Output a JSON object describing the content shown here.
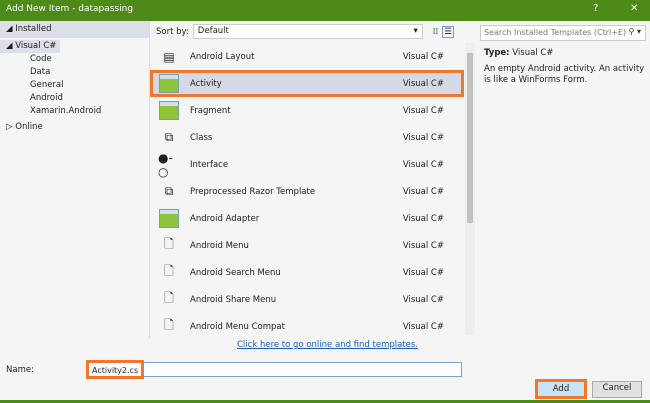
{
  "window": {
    "title": "Add New Item - datapassing",
    "help": "?",
    "close": "✕"
  },
  "sidebar": {
    "installed": "Installed",
    "tree": [
      "Visual C#",
      "Code",
      "Data",
      "General",
      "Android",
      "Xamarin.Android"
    ],
    "online": "Online"
  },
  "sort": {
    "label": "Sort by:",
    "value": "Default"
  },
  "templates": [
    {
      "name": "Android Layout",
      "lang": "Visual C#",
      "icon": "layout-icon"
    },
    {
      "name": "Activity",
      "lang": "Visual C#",
      "icon": "android-icon",
      "selected": true
    },
    {
      "name": "Fragment",
      "lang": "Visual C#",
      "icon": "android-icon"
    },
    {
      "name": "Class",
      "lang": "Visual C#",
      "icon": "class-icon"
    },
    {
      "name": "Interface",
      "lang": "Visual C#",
      "icon": "interface-icon"
    },
    {
      "name": "Preprocessed Razor Template",
      "lang": "Visual C#",
      "icon": "razor-icon"
    },
    {
      "name": "Android Adapter",
      "lang": "Visual C#",
      "icon": "android-icon"
    },
    {
      "name": "Android Menu",
      "lang": "Visual C#",
      "icon": "file-icon"
    },
    {
      "name": "Android Search Menu",
      "lang": "Visual C#",
      "icon": "file-icon"
    },
    {
      "name": "Android Share Menu",
      "lang": "Visual C#",
      "icon": "file-icon"
    },
    {
      "name": "Android Menu Compat",
      "lang": "Visual C#",
      "icon": "file-icon"
    }
  ],
  "details": {
    "search_placeholder": "Search Installed Templates (Ctrl+E)",
    "type_label": "Type:",
    "type_value": "Visual C#",
    "description": "An empty Android activity.  An activity is like a WinForms Form."
  },
  "online_link": "Click here to go online and find templates.",
  "name": {
    "label": "Name:",
    "value": "Activity2.cs"
  },
  "buttons": {
    "add": "Add",
    "cancel": "Cancel"
  },
  "colors": {
    "titlebar": "#4e8a18",
    "highlight": "#f07828"
  }
}
